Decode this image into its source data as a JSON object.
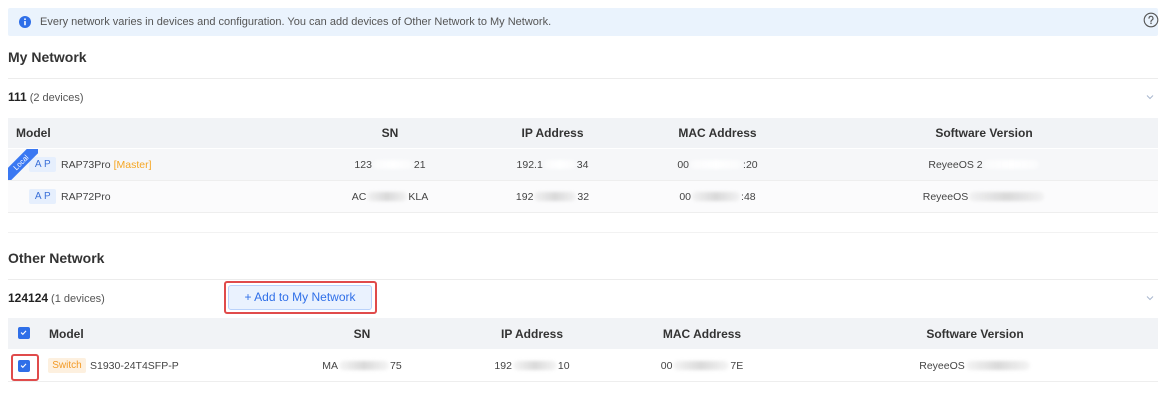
{
  "banner": {
    "icon": "info-icon",
    "text": "Every network varies in devices and configuration. You can add devices of Other Network to My Network.",
    "help_icon": "help-icon"
  },
  "my_network": {
    "title": "My Network",
    "group": {
      "name": "111",
      "count": "(2 devices)",
      "expand_icon": "chevron-down-icon"
    },
    "columns": {
      "model": "Model",
      "sn": "SN",
      "ip": "IP Address",
      "mac": "MAC Address",
      "software": "Software Version"
    },
    "rows": [
      {
        "local_tag": "Local",
        "type": "AP",
        "model": "RAP73Pro",
        "role": "[Master]",
        "sn": {
          "start": "123",
          "end": "21"
        },
        "ip": {
          "start": "192.1",
          "end": "34"
        },
        "mac": {
          "start": "00",
          "end": ":20"
        },
        "software": {
          "start": "ReyeeOS 2"
        }
      },
      {
        "type": "AP",
        "model": "RAP72Pro",
        "sn": {
          "start": "AC",
          "end": "KLA"
        },
        "ip": {
          "start": "192",
          "end": "32"
        },
        "mac": {
          "start": "00",
          "end": ":48"
        },
        "software": {
          "start": "ReyeeOS"
        }
      }
    ]
  },
  "other_network": {
    "title": "Other Network",
    "group": {
      "name": "124124",
      "count": "(1 devices)",
      "expand_icon": "chevron-down-icon"
    },
    "add_button": "+ Add to My Network",
    "select_all_checked": true,
    "columns": {
      "model": "Model",
      "sn": "SN",
      "ip": "IP Address",
      "mac": "MAC Address",
      "software": "Software Version"
    },
    "rows": [
      {
        "checked": true,
        "type": "Switch",
        "model": "S1930-24T4SFP-P",
        "sn": {
          "start": "MA",
          "end": "75"
        },
        "ip": {
          "start": "192",
          "end": "10"
        },
        "mac": {
          "start": "00",
          "end": "7E"
        },
        "software": {
          "start": "ReyeeOS"
        }
      }
    ]
  },
  "colors": {
    "accent": "#2f6fe8",
    "highlight_box": "#e04b4b",
    "master_orange": "#f5a623",
    "switch_orange": "#f39a26",
    "banner_bg": "#eaf3fd",
    "table_header_bg": "#f1f3f6"
  }
}
